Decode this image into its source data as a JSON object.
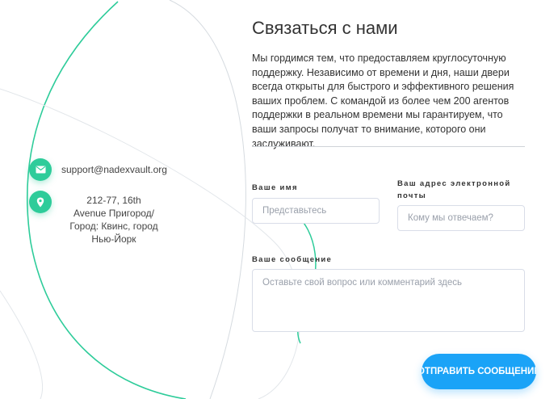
{
  "contacts": {
    "email": "support@nadexvault.org",
    "address": "212-77, 16th Avenue Пригород/Город: Квинс, город Нью-Йорк"
  },
  "icons": {
    "email": "envelope-icon",
    "address": "map-pin-icon"
  },
  "colors": {
    "accent": "#2ecc9a",
    "button": "#1aa3f7"
  },
  "header": {
    "title": "Связаться с нами",
    "intro": "Мы гордимся тем, что предоставляем круглосуточную поддержку. Независимо от времени и дня, наши двери всегда открыты для быстрого и эффективного решения ваших проблем. С командой из более чем 200 агентов поддержки в реальном времени мы гарантируем, что ваши запросы получат то внимание, которого они заслуживают."
  },
  "form": {
    "name_label": "Ваше имя",
    "name_placeholder": "Представьтесь",
    "email_label": "Ваш адрес электронной почты",
    "email_placeholder": "Кому мы отвечаем?",
    "message_label": "Ваше сообщение",
    "message_placeholder": "Оставьте свой вопрос или комментарий здесь",
    "submit_label": "Отправить сообщение"
  }
}
